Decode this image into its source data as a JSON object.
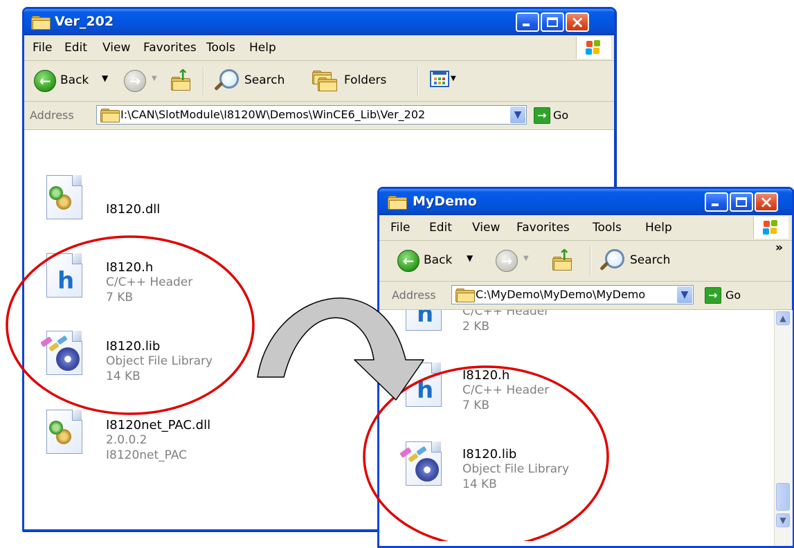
{
  "window1": {
    "title": "Ver_202",
    "menu": [
      "File",
      "Edit",
      "View",
      "Favorites",
      "Tools",
      "Help"
    ],
    "toolbar": {
      "back": "Back",
      "search": "Search",
      "folders": "Folders"
    },
    "address": {
      "label": "Address",
      "path": "I:\\CAN\\SlotModule\\I8120W\\Demos\\WinCE6_Lib\\Ver_202",
      "go": "Go"
    },
    "files": [
      {
        "name": "I8120.dll",
        "line1": "",
        "line2": "",
        "icon": "dll-icon"
      },
      {
        "name": "I8120.h",
        "line1": "C/C++ Header",
        "line2": "7 KB",
        "icon": "header-file-icon"
      },
      {
        "name": "I8120.lib",
        "line1": "Object File Library",
        "line2": "14 KB",
        "icon": "library-file-icon"
      },
      {
        "name": "I8120net_PAC.dll",
        "line1": "2.0.0.2",
        "line2": "I8120net_PAC",
        "icon": "dll-icon"
      }
    ]
  },
  "window2": {
    "title": "MyDemo",
    "menu": [
      "File",
      "Edit",
      "View",
      "Favorites",
      "Tools",
      "Help"
    ],
    "toolbar": {
      "back": "Back",
      "search": "Search",
      "more": "»"
    },
    "address": {
      "label": "Address",
      "path": "C:\\MyDemo\\MyDemo\\MyDemo",
      "go": "Go"
    },
    "files": [
      {
        "name": "",
        "line1": "C/C++ Header",
        "line2": "2 KB",
        "icon": "header-file-icon"
      },
      {
        "name": "I8120.h",
        "line1": "C/C++ Header",
        "line2": "7 KB",
        "icon": "header-file-icon"
      },
      {
        "name": "I8120.lib",
        "line1": "Object File Library",
        "line2": "14 KB",
        "icon": "library-file-icon"
      }
    ]
  },
  "colors": {
    "annotation": "#e00000",
    "arrow_fill": "#c8c8c8",
    "titlebar": "#0457e3"
  }
}
